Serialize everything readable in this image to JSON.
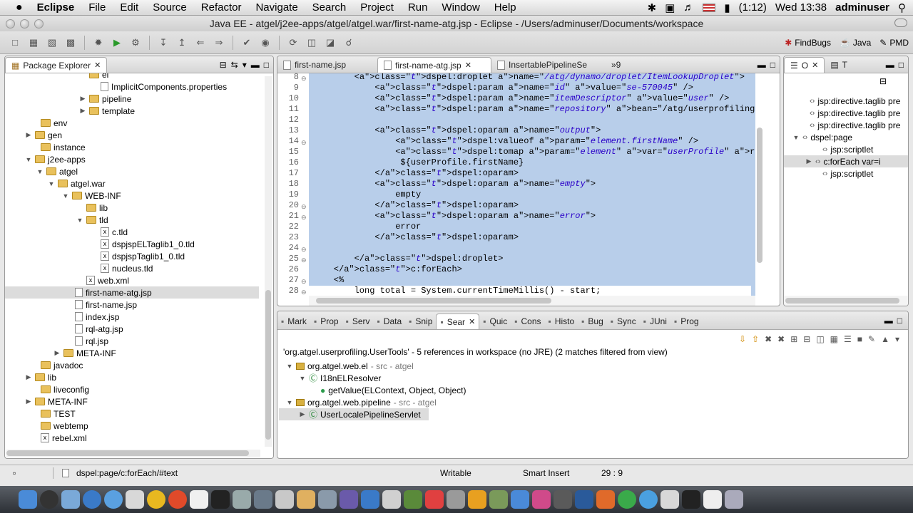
{
  "menubar": {
    "app": "Eclipse",
    "items": [
      "File",
      "Edit",
      "Source",
      "Refactor",
      "Navigate",
      "Search",
      "Project",
      "Run",
      "Window",
      "Help"
    ],
    "battery": "(1:12)",
    "clock": "Wed 13:38",
    "user": "adminuser"
  },
  "window": {
    "title": "Java EE - atgel/j2ee-apps/atgel/atgel.war/first-name-atg.jsp - Eclipse - /Users/adminuser/Documents/workspace"
  },
  "toolbar": {
    "perspectives": [
      "FindBugs",
      "Java",
      "PMD"
    ]
  },
  "package_explorer": {
    "title": "Package Explorer",
    "items": [
      {
        "label": "el",
        "twisty": "",
        "kind": "folder"
      },
      {
        "label": "ImplicitComponents.properties",
        "twisty": "",
        "kind": "file"
      },
      {
        "label": "pipeline",
        "twisty": "▶",
        "kind": "folder"
      },
      {
        "label": "template",
        "twisty": "▶",
        "kind": "folder"
      },
      {
        "label": "env",
        "twisty": "",
        "kind": "folder"
      },
      {
        "label": "gen",
        "twisty": "▶",
        "kind": "folder"
      },
      {
        "label": "instance",
        "twisty": "",
        "kind": "folder"
      },
      {
        "label": "j2ee-apps",
        "twisty": "▼",
        "kind": "folder"
      },
      {
        "label": "atgel",
        "twisty": "▼",
        "kind": "folder"
      },
      {
        "label": "atgel.war",
        "twisty": "▼",
        "kind": "folder"
      },
      {
        "label": "WEB-INF",
        "twisty": "▼",
        "kind": "folder"
      },
      {
        "label": "lib",
        "twisty": "",
        "kind": "folder"
      },
      {
        "label": "tld",
        "twisty": "▼",
        "kind": "folder"
      },
      {
        "label": "c.tld",
        "twisty": "",
        "kind": "xfile"
      },
      {
        "label": "dspjspELTaglib1_0.tld",
        "twisty": "",
        "kind": "xfile"
      },
      {
        "label": "dspjspTaglib1_0.tld",
        "twisty": "",
        "kind": "xfile"
      },
      {
        "label": "nucleus.tld",
        "twisty": "",
        "kind": "xfile"
      },
      {
        "label": "web.xml",
        "twisty": "",
        "kind": "xfile"
      },
      {
        "label": "first-name-atg.jsp",
        "twisty": "",
        "kind": "file"
      },
      {
        "label": "first-name.jsp",
        "twisty": "",
        "kind": "file"
      },
      {
        "label": "index.jsp",
        "twisty": "",
        "kind": "file"
      },
      {
        "label": "rql-atg.jsp",
        "twisty": "",
        "kind": "file"
      },
      {
        "label": "rql.jsp",
        "twisty": "",
        "kind": "file"
      },
      {
        "label": "META-INF",
        "twisty": "▶",
        "kind": "folder"
      },
      {
        "label": "javadoc",
        "twisty": "",
        "kind": "folder"
      },
      {
        "label": "lib",
        "twisty": "▶",
        "kind": "folder"
      },
      {
        "label": "liveconfig",
        "twisty": "",
        "kind": "folder"
      },
      {
        "label": "META-INF",
        "twisty": "▶",
        "kind": "folder"
      },
      {
        "label": "TEST",
        "twisty": "",
        "kind": "folder"
      },
      {
        "label": "webtemp",
        "twisty": "",
        "kind": "folder"
      },
      {
        "label": "rebel.xml",
        "twisty": "",
        "kind": "xfile"
      }
    ]
  },
  "editor": {
    "tabs": [
      "first-name.jsp",
      "first-name-atg.jsp",
      "InsertablePipelineSe"
    ],
    "overflow": "»9",
    "lines": [
      {
        "n": "8",
        "code": "        <dspel:droplet name=\"/atg/dynamo/droplet/ItemLookupDroplet\">"
      },
      {
        "n": "9",
        "code": "            <dspel:param name=\"id\" value=\"se-570045\" />"
      },
      {
        "n": "10",
        "code": "            <dspel:param name=\"itemDescriptor\" value=\"user\" />"
      },
      {
        "n": "11",
        "code": "            <dspel:param name=\"repository\" bean=\"/atg/userprofiling/ProfileAdapte"
      },
      {
        "n": "12",
        "code": ""
      },
      {
        "n": "13",
        "code": "            <dspel:oparam name=\"output\">"
      },
      {
        "n": "14",
        "code": "                <dspel:valueof param=\"element.firstName\" />"
      },
      {
        "n": "15",
        "code": "                <dspel:tomap param=\"element\" var=\"userProfile\" recursive=\"true\" /"
      },
      {
        "n": "16",
        "code": "                 ${userProfile.firstName}"
      },
      {
        "n": "17",
        "code": "            </dspel:oparam>"
      },
      {
        "n": "18",
        "code": "            <dspel:oparam name=\"empty\">"
      },
      {
        "n": "19",
        "code": "                empty"
      },
      {
        "n": "20",
        "code": "            </dspel:oparam>"
      },
      {
        "n": "21",
        "code": "            <dspel:oparam name=\"error\">"
      },
      {
        "n": "22",
        "code": "                error"
      },
      {
        "n": "23",
        "code": "            </dspel:oparam>"
      },
      {
        "n": "24",
        "code": ""
      },
      {
        "n": "25",
        "code": "        </dspel:droplet>"
      },
      {
        "n": "26",
        "code": "    </c:forEach>"
      },
      {
        "n": "27",
        "code": "    <%"
      },
      {
        "n": "28",
        "code": "        long total = System.currentTimeMillis() - start;"
      }
    ]
  },
  "outline": {
    "tabs": [
      "O",
      "T"
    ],
    "items": [
      {
        "label": "jsp:directive.taglib pre",
        "twisty": ""
      },
      {
        "label": "jsp:directive.taglib pre",
        "twisty": ""
      },
      {
        "label": "jsp:directive.taglib pre",
        "twisty": ""
      },
      {
        "label": "dspel:page",
        "twisty": "▼"
      },
      {
        "label": "jsp:scriptlet",
        "twisty": ""
      },
      {
        "label": "c:forEach var=i",
        "twisty": "▶"
      },
      {
        "label": "jsp:scriptlet",
        "twisty": ""
      }
    ]
  },
  "bottom": {
    "tabs": [
      "Mark",
      "Prop",
      "Serv",
      "Data",
      "Snip",
      "Sear",
      "Quic",
      "Cons",
      "Histo",
      "Bug",
      "Sync",
      "JUni",
      "Prog"
    ],
    "search_header": "'org.atgel.userprofiling.UserTools' - 5 references in workspace (no JRE) (2 matches filtered from view)",
    "results": [
      {
        "label": "org.atgel.web.el",
        "suffix": " - src - atgel",
        "twisty": "▼"
      },
      {
        "label": "I18nELResolver",
        "suffix": "",
        "twisty": "▼"
      },
      {
        "label": "getValue(ELContext, Object, Object)",
        "suffix": "",
        "twisty": ""
      },
      {
        "label": "org.atgel.web.pipeline",
        "suffix": " - src - atgel",
        "twisty": "▼"
      },
      {
        "label": "UserLocalePipelineServlet",
        "suffix": "",
        "twisty": "▶"
      }
    ]
  },
  "status": {
    "path": "dspel:page/c:forEach/#text",
    "writable": "Writable",
    "insert": "Smart Insert",
    "position": "29 : 9"
  }
}
